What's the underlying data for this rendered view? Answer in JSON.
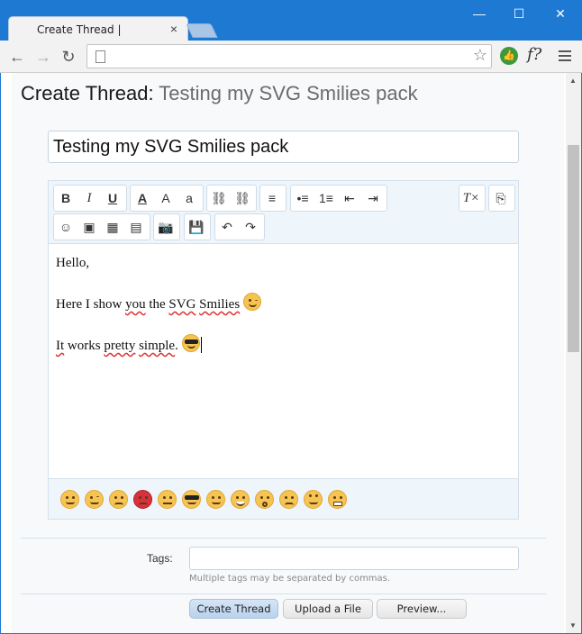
{
  "browser": {
    "tab_title": "Create Thread |",
    "tab_close": "×",
    "url": "",
    "win_min": "—",
    "win_max": "☐",
    "win_close": "✕",
    "ext_f": "f?"
  },
  "page": {
    "heading_prefix": "Create Thread:",
    "heading_thread": "Testing my SVG Smilies pack"
  },
  "form": {
    "title_value": "Testing my SVG Smilies pack",
    "editor_lines": [
      {
        "text": "Hello,"
      },
      {
        "before": "Here I show ",
        "w1": "you",
        "mid1": " the ",
        "w2": "SVG",
        "mid2": " ",
        "w3": "Smilies"
      },
      {
        "w1": "It",
        "mid1": " works ",
        "w2": "pretty",
        "mid2": " ",
        "w3": "simple",
        "after": "."
      }
    ],
    "tags_label": "Tags:",
    "tags_value": "",
    "tags_hint": "Multiple tags may be separated by commas.",
    "buttons": {
      "create": "Create Thread",
      "upload": "Upload a File",
      "preview": "Preview..."
    }
  },
  "editor_toolbar": {
    "bold": "B",
    "italic": "I",
    "underline": "U",
    "font_color": "A",
    "font_size": "A",
    "font_family": "a"
  },
  "smilies": [
    "smile",
    "wink",
    "frown",
    "angry",
    "neutral",
    "cool",
    "tongue",
    "grin",
    "surprised",
    "sweat",
    "rolleyes",
    "grimace"
  ],
  "colors": {
    "chrome_blue": "#1e79d3",
    "toolbar_bg": "#eef6fc",
    "button_primary": "#c9ddf1"
  }
}
